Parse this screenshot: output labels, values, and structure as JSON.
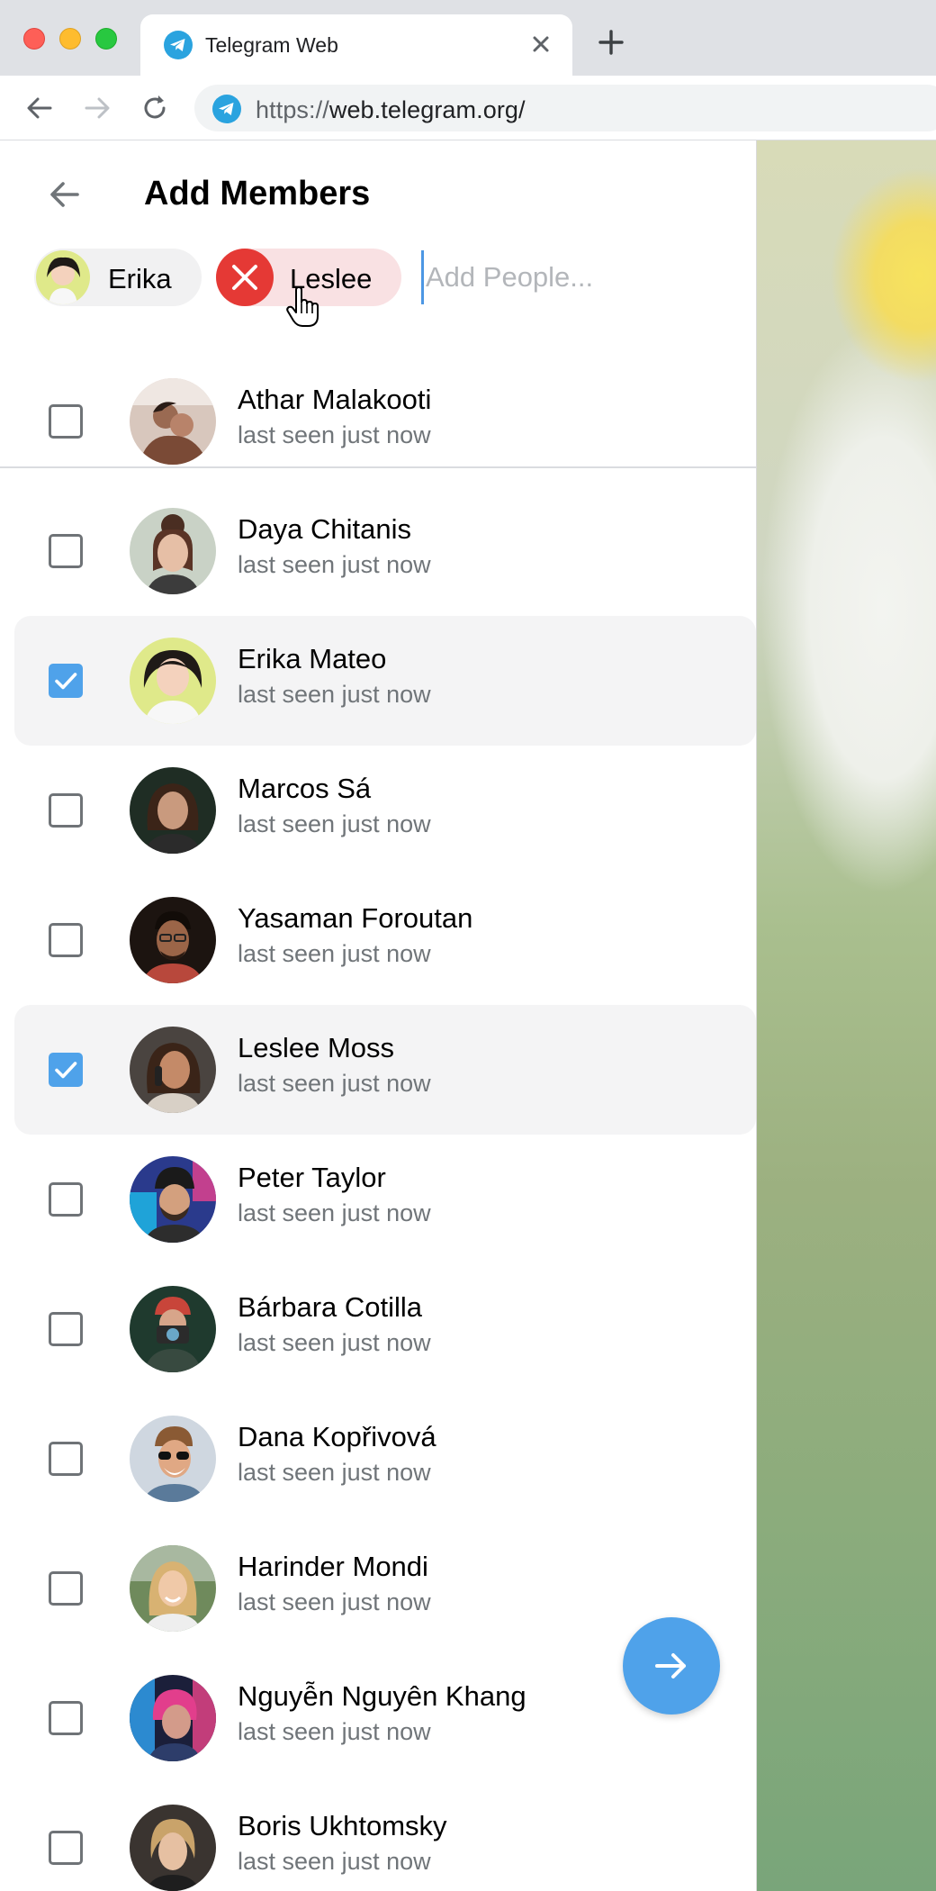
{
  "browser": {
    "tab_title": "Telegram Web",
    "url_protocol": "https://",
    "url_host": "web.telegram.org/",
    "tab_favicon": "telegram-icon",
    "colors": {
      "chrome": "#dfe1e5",
      "telegram_blue": "#4fa2ea"
    }
  },
  "header": {
    "title": "Add Members",
    "back_icon": "arrow-left-icon"
  },
  "chips": [
    {
      "label": "Erika",
      "state": "normal"
    },
    {
      "label": "Leslee",
      "state": "hovered-remove"
    }
  ],
  "search": {
    "placeholder": "Add People...",
    "value": ""
  },
  "contacts": [
    {
      "name": "Athar Malakooti",
      "status": "last seen just now",
      "checked": false
    },
    {
      "name": "Daya Chitanis",
      "status": "last seen just now",
      "checked": false
    },
    {
      "name": "Erika Mateo",
      "status": "last seen just now",
      "checked": true
    },
    {
      "name": "Marcos Sá",
      "status": "last seen just now",
      "checked": false
    },
    {
      "name": "Yasaman Foroutan",
      "status": "last seen just now",
      "checked": false
    },
    {
      "name": "Leslee Moss",
      "status": "last seen just now",
      "checked": true
    },
    {
      "name": "Peter Taylor",
      "status": "last seen just now",
      "checked": false
    },
    {
      "name": "Bárbara Cotilla",
      "status": "last seen just now",
      "checked": false
    },
    {
      "name": "Dana Kopřivová",
      "status": "last seen just now",
      "checked": false
    },
    {
      "name": "Harinder Mondi",
      "status": "last seen just now",
      "checked": false
    },
    {
      "name": "Nguyễn Nguyên Khang",
      "status": "last seen just now",
      "checked": false
    },
    {
      "name": "Boris Ukhtomsky",
      "status": "last seen just now",
      "checked": false
    }
  ],
  "fab": {
    "icon": "arrow-right-icon"
  }
}
